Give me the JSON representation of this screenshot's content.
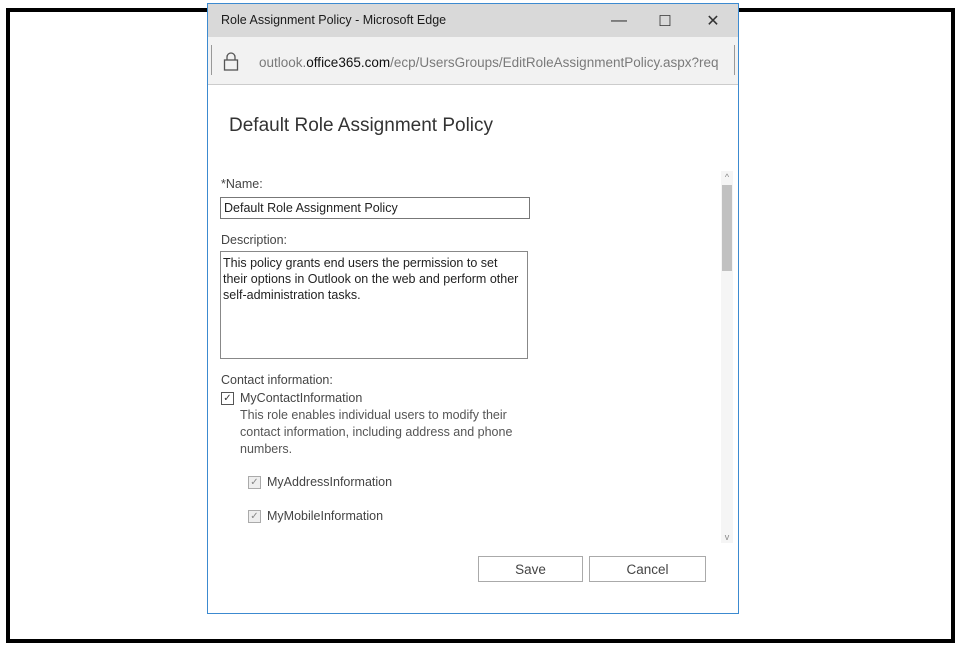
{
  "window": {
    "title": "Role Assignment Policy - Microsoft Edge",
    "minimize_glyph": "—",
    "maximize_glyph": "☐",
    "close_glyph": "✕"
  },
  "address_bar": {
    "url_prefix": "outlook.",
    "url_domain": "office365.com",
    "url_path": "/ecp/UsersGroups/EditRoleAssignmentPolicy.aspx?req",
    "lock_icon": "lock-icon"
  },
  "form": {
    "title": "Default Role Assignment Policy",
    "name_label": "*Name:",
    "name_value": "Default Role Assignment Policy",
    "description_label": "Description:",
    "description_value": "This policy grants end users the permission to set their options in Outlook on the web and perform other self-administration tasks.",
    "contact_section_label": "Contact information:",
    "roles": [
      {
        "label": "MyContactInformation",
        "checked": true,
        "description": "This role enables individual users to modify their contact information, including address and phone numbers."
      },
      {
        "label": "MyAddressInformation",
        "checked": true,
        "disabled": true
      },
      {
        "label": "MyMobileInformation",
        "checked": true,
        "disabled": true
      }
    ]
  },
  "buttons": {
    "save": "Save",
    "cancel": "Cancel"
  },
  "scrollbar": {
    "up_glyph": "^",
    "down_glyph": "v"
  },
  "colors": {
    "window_border": "#3c8ad0",
    "titlebar": "#d9d9d9"
  }
}
